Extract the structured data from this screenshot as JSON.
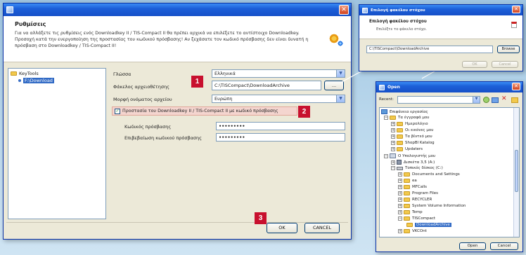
{
  "settings_dialog": {
    "title": "",
    "heading": "Ρυθμίσεις",
    "description": "Για να αλλάξετε τις ρυθμίσεις ενός Downloadkey II / TIS-Compact II θα πρέπει αρχικά να επιλέξετε το αντίστοιχο Downloadkey. Προσοχή κατά την ενεργοποίηση της προστασίας του κωδικού πρόσβασης! Αν ξεχάσατε τον κωδικό πρόσβασης δεν είναι δυνατή η πρόσβαση στο Downloadkey / TIS-Compact II!",
    "tree": {
      "root": "KeyTools",
      "child": "F:\\Download"
    },
    "form": {
      "language_label": "Γλώσσα",
      "language_value": "Ελληνικά",
      "folder_label": "Φάκελος αρχειοθέτησης",
      "folder_value": "C:\\TISCompact\\DownloadArchive",
      "browse_label": "...",
      "filename_format_label": "Μορφή ονόματος αρχείου",
      "filename_format_value": "Ευρώπη",
      "protection_label": "Προστασία του Downloadkey II / TIS-Compact II με κωδικό πρόσβασης",
      "protection_checked": true,
      "password_label": "Κωδικός πρόσβασης",
      "password_value": "•••••••••",
      "confirm_label": "Επιβεβαίωση κωδικού πρόσβασης",
      "confirm_value": "•••••••••"
    },
    "ok_label": "OK",
    "cancel_label": "CANCEL"
  },
  "badges": [
    "1",
    "2",
    "3"
  ],
  "folder_dialog": {
    "title": "Επιλογή φακέλου στόχου",
    "heading": "Επιλογή φακέλου στόχου",
    "subheading": "Επιλέξτε το φάκελο στόχο.",
    "path_value": "C:\\TISCompact\\DownloadArchive",
    "browse_label": "Browse",
    "ok_label": "OK",
    "cancel_label": "Cancel"
  },
  "open_dialog": {
    "title": "Open",
    "recent_label": "Recent:",
    "tree_items": [
      "Επιφάνεια εργασίας",
      "Τα έγγραφά μου",
      "Ημερολόγιο",
      "Οι εικόνες μου",
      "Τα βίντεό μου",
      "ShopBl Katalog",
      "Updaters",
      "Ο Υπολογιστής μου",
      "Δισκέτα 3,5 (A:)",
      "Τοπικός δίσκος (C:)",
      "Documents and Settings",
      "ea",
      "MFCalls",
      "Program Files",
      "RECYCLER",
      "System Volume Information",
      "Temp",
      "TISCompact",
      "DownloadArchive",
      "VKCOnt"
    ],
    "open_label": "Open",
    "cancel_label": "Cancel"
  },
  "colors": {
    "titlebar": "#1c5fd8",
    "badge": "#c8102e",
    "highlight_row": "#f4d5cf",
    "selection": "#316ac5"
  }
}
